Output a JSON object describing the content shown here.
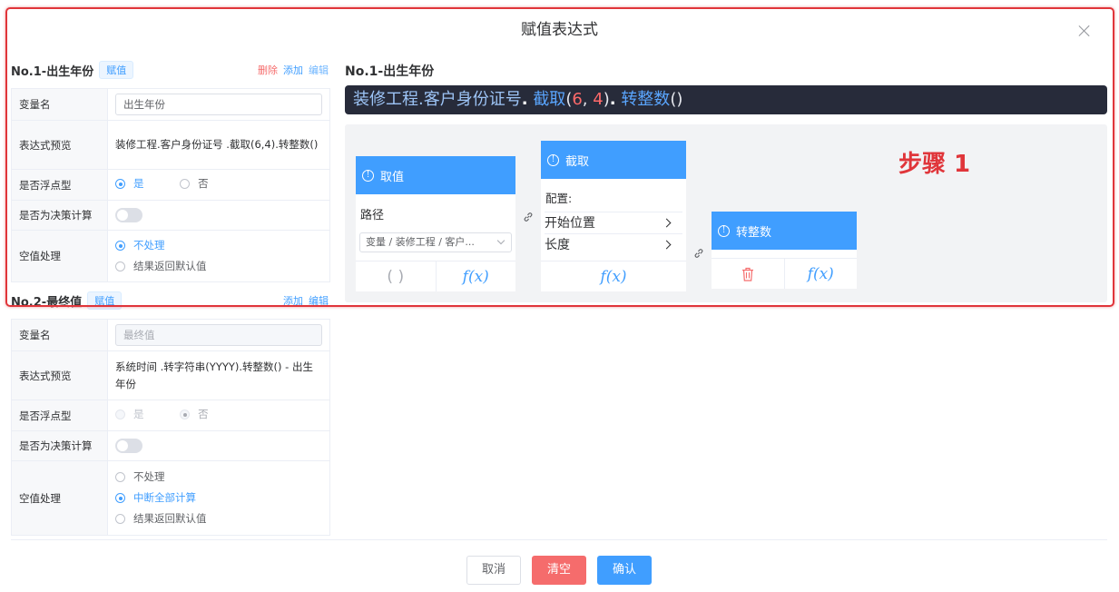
{
  "dialog": {
    "title": "赋值表达式"
  },
  "step_label": "步骤 1",
  "items": [
    {
      "title": "No.1-出生年份",
      "tag": "赋值",
      "actions": {
        "delete": "删除",
        "add": "添加",
        "edit": "编辑"
      },
      "rows": {
        "var_label": "变量名",
        "var_value": "出生年份",
        "preview_label": "表达式预览",
        "preview_value": "装修工程.客户身份证号 .截取(6,4).转整数()",
        "float_label": "是否浮点型",
        "float_yes": "是",
        "float_no": "否",
        "float_selected": "是",
        "decision_label": "是否为决策计算",
        "decision_on": false,
        "null_label": "空值处理",
        "null_options": [
          "不处理",
          "结果返回默认值"
        ],
        "null_selected": "不处理"
      }
    },
    {
      "title": "No.2-最终值",
      "tag": "赋值",
      "actions": {
        "add": "添加",
        "edit": "编辑"
      },
      "rows": {
        "var_label": "变量名",
        "var_placeholder": "最终值",
        "preview_label": "表达式预览",
        "preview_value": "系统时间 .转字符串(YYYY).转整数() - 出生年份",
        "float_label": "是否浮点型",
        "float_yes": "是",
        "float_no": "否",
        "float_selected": "否",
        "decision_label": "是否为决策计算",
        "decision_on": false,
        "null_label": "空值处理",
        "null_options": [
          "不处理",
          "中断全部计算",
          "结果返回默认值"
        ],
        "null_selected": "中断全部计算"
      }
    }
  ],
  "editor": {
    "title": "No.1-出生年份",
    "expression": {
      "path": "装修工程.客户身份证号",
      "dot": ".",
      "fn1": "截取",
      "open": "(",
      "arg1": "6",
      "comma": ", ",
      "arg2": "4",
      "close": ")",
      "fn2": "转整数",
      "parens": "()"
    },
    "nodes": {
      "get": {
        "title": "取值",
        "path_label": "路径",
        "path_value": "变量 / 装修工程 / 客户...",
        "foot_left": "( )",
        "foot_right": "f(x)"
      },
      "substr": {
        "title": "截取",
        "config_label": "配置:",
        "param_start": "开始位置",
        "param_length": "长度",
        "foot": "f(x)"
      },
      "toint": {
        "title": "转整数",
        "foot_right": "f(x)"
      }
    }
  },
  "footer": {
    "cancel": "取消",
    "clear": "清空",
    "confirm": "确认"
  },
  "colors": {
    "primary": "#409eff",
    "danger": "#f56c6c",
    "highlight": "#e0353a",
    "code_bg": "#272b3a"
  }
}
